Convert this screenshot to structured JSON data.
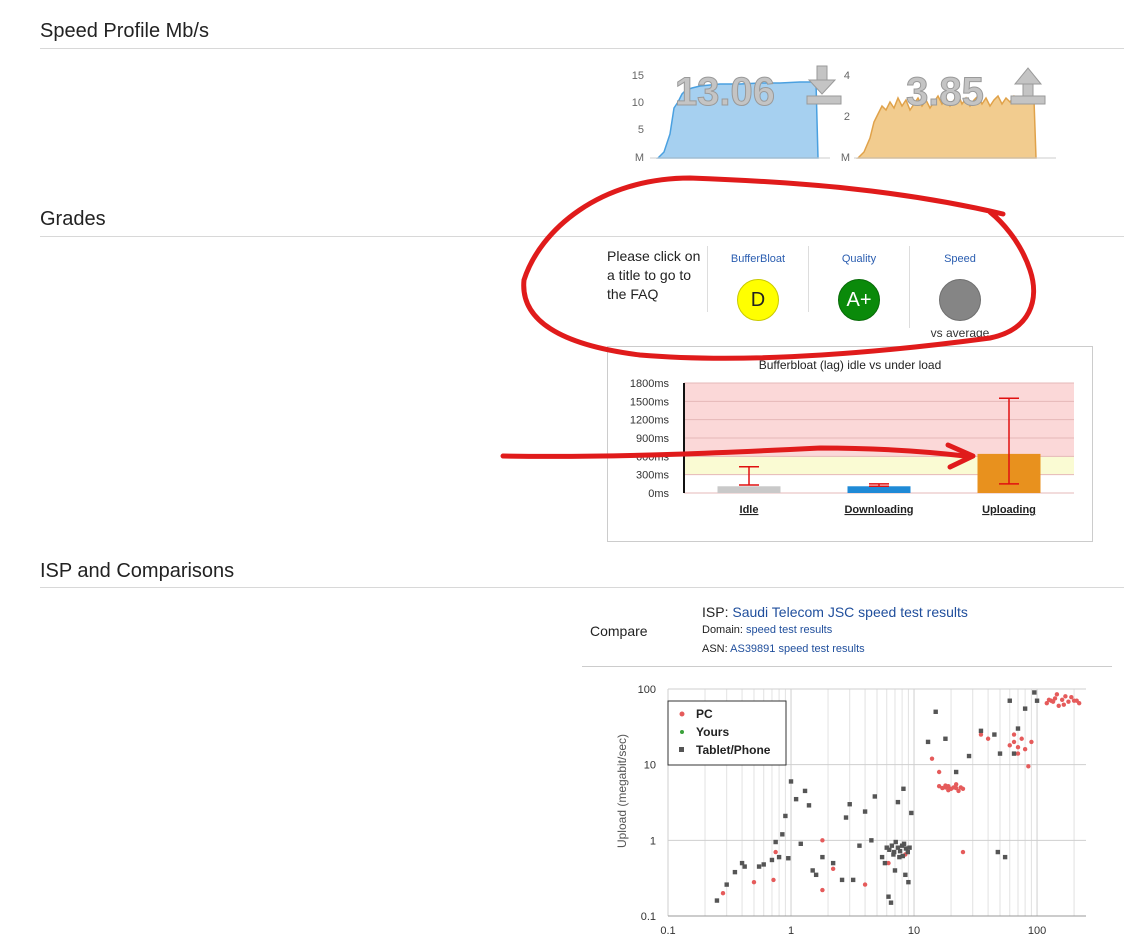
{
  "sections": {
    "speed_profile": "Speed Profile Mb/s",
    "grades": "Grades",
    "isp": "ISP and Comparisons"
  },
  "speed_profile": {
    "download_value": "13.06",
    "upload_value": "3.85",
    "download_axis": [
      "15",
      "10",
      "5",
      "M"
    ],
    "upload_axis": [
      "4",
      "2",
      "M"
    ],
    "download_color": "#6ab0e6",
    "upload_color": "#f0c37a"
  },
  "grades": {
    "intro": "Please click on a title to go to the FAQ",
    "items": [
      {
        "title": "BufferBloat",
        "grade": "D",
        "color": "#ffff00",
        "text_color": "#222"
      },
      {
        "title": "Quality",
        "grade": "A+",
        "color": "#0a8a0a",
        "text_color": "#ffffff"
      },
      {
        "title": "Speed",
        "grade": "",
        "color": "#858585",
        "text_color": "#ffffff",
        "sub": "vs average"
      }
    ]
  },
  "chart_data": [
    {
      "type": "bar",
      "title": "Bufferbloat (lag) idle vs under load",
      "categories": [
        "Idle",
        "Downloading",
        "Uploading"
      ],
      "y_tick_labels": [
        "1800ms",
        "1500ms",
        "1200ms",
        "900ms",
        "600ms",
        "300ms",
        "0ms"
      ],
      "ylim": [
        0,
        1800
      ],
      "values": [
        110,
        110,
        640
      ],
      "error_ranges": [
        [
          130,
          430
        ],
        [
          110,
          150
        ],
        [
          150,
          1550
        ]
      ],
      "colors": [
        "#c9c9c9",
        "#1f8ad6",
        "#e8911e"
      ],
      "zones": [
        {
          "from": 0,
          "to": 300,
          "color": "#ffffff"
        },
        {
          "from": 300,
          "to": 600,
          "color": "#fafbd3"
        },
        {
          "from": 600,
          "to": 1800,
          "color": "#fbd8d8"
        }
      ]
    },
    {
      "type": "scatter",
      "ylabel": "Upload (megabit/sec)",
      "x_scale": "log",
      "y_scale": "log",
      "xlim": [
        0.1,
        250
      ],
      "ylim": [
        0.1,
        100
      ],
      "x_tick_labels": [
        "0.1",
        "1",
        "10",
        "100"
      ],
      "y_tick_labels": [
        "100",
        "10",
        "1",
        "0.1"
      ],
      "legend_position": "top-left",
      "series": [
        {
          "name": "PC",
          "color": "#e55b5b",
          "shape": "circle",
          "points": [
            [
              0.28,
              0.2
            ],
            [
              0.5,
              0.28
            ],
            [
              0.72,
              0.3
            ],
            [
              1.8,
              0.22
            ],
            [
              2.2,
              0.42
            ],
            [
              4,
              0.26
            ],
            [
              6.2,
              0.5
            ],
            [
              8.5,
              0.65
            ],
            [
              1.8,
              1.0
            ],
            [
              0.75,
              0.7
            ],
            [
              14,
              12
            ],
            [
              16,
              8
            ],
            [
              18,
              5
            ],
            [
              19,
              5.2
            ],
            [
              20,
              4.8
            ],
            [
              21,
              5
            ],
            [
              22,
              5.5
            ],
            [
              23,
              4.5
            ],
            [
              24,
              5
            ],
            [
              25,
              4.8
            ],
            [
              16,
              5.2
            ],
            [
              17,
              4.9
            ],
            [
              18,
              5.3
            ],
            [
              19,
              4.6
            ],
            [
              22,
              4.9
            ],
            [
              25,
              0.7
            ],
            [
              35,
              25
            ],
            [
              40,
              22
            ],
            [
              60,
              18
            ],
            [
              65,
              20
            ],
            [
              70,
              17
            ],
            [
              75,
              22
            ],
            [
              80,
              16
            ],
            [
              85,
              9.5
            ],
            [
              65,
              25
            ],
            [
              70,
              14
            ],
            [
              90,
              20
            ],
            [
              120,
              65
            ],
            [
              130,
              70
            ],
            [
              140,
              75
            ],
            [
              150,
              60
            ],
            [
              160,
              72
            ],
            [
              170,
              80
            ],
            [
              180,
              68
            ],
            [
              200,
              70
            ],
            [
              220,
              65
            ],
            [
              135,
              68
            ],
            [
              125,
              72
            ],
            [
              190,
              78
            ],
            [
              165,
              62
            ],
            [
              145,
              85
            ],
            [
              210,
              70
            ]
          ]
        },
        {
          "name": "Yours",
          "color": "#3aa13a",
          "shape": "circle",
          "points": []
        },
        {
          "name": "Tablet/Phone",
          "color": "#555555",
          "shape": "square",
          "points": [
            [
              0.25,
              0.16
            ],
            [
              0.3,
              0.26
            ],
            [
              0.35,
              0.38
            ],
            [
              0.4,
              0.5
            ],
            [
              0.42,
              0.45
            ],
            [
              0.55,
              0.45
            ],
            [
              0.6,
              0.48
            ],
            [
              0.7,
              0.55
            ],
            [
              0.75,
              0.95
            ],
            [
              0.8,
              0.6
            ],
            [
              0.85,
              1.2
            ],
            [
              0.9,
              2.1
            ],
            [
              0.95,
              0.58
            ],
            [
              1.0,
              6
            ],
            [
              1.1,
              3.5
            ],
            [
              1.2,
              0.9
            ],
            [
              1.3,
              4.5
            ],
            [
              1.4,
              2.9
            ],
            [
              1.5,
              0.4
            ],
            [
              1.6,
              0.35
            ],
            [
              1.8,
              0.6
            ],
            [
              2.2,
              0.5
            ],
            [
              2.6,
              0.3
            ],
            [
              2.8,
              2.0
            ],
            [
              3.0,
              3.0
            ],
            [
              3.2,
              0.3
            ],
            [
              3.6,
              0.85
            ],
            [
              4.0,
              2.4
            ],
            [
              4.5,
              1.0
            ],
            [
              4.8,
              3.8
            ],
            [
              5.5,
              0.6
            ],
            [
              5.8,
              0.5
            ],
            [
              6.2,
              0.18
            ],
            [
              6.5,
              0.15
            ],
            [
              6.0,
              0.8
            ],
            [
              6.3,
              0.75
            ],
            [
              6.6,
              0.85
            ],
            [
              6.9,
              0.7
            ],
            [
              7.1,
              0.95
            ],
            [
              7.4,
              0.8
            ],
            [
              7.7,
              0.72
            ],
            [
              8.0,
              0.85
            ],
            [
              8.3,
              0.9
            ],
            [
              8.6,
              0.78
            ],
            [
              8.9,
              0.7
            ],
            [
              9.2,
              0.8
            ],
            [
              6.8,
              0.65
            ],
            [
              7.6,
              0.6
            ],
            [
              8.1,
              0.62
            ],
            [
              7.0,
              0.4
            ],
            [
              8.5,
              0.35
            ],
            [
              9.0,
              0.28
            ],
            [
              7.4,
              3.2
            ],
            [
              8.2,
              4.8
            ],
            [
              9.5,
              2.3
            ],
            [
              13,
              20
            ],
            [
              15,
              50
            ],
            [
              18,
              22
            ],
            [
              22,
              8
            ],
            [
              28,
              13
            ],
            [
              35,
              28
            ],
            [
              45,
              25
            ],
            [
              48,
              0.7
            ],
            [
              50,
              14
            ],
            [
              55,
              0.6
            ],
            [
              65,
              14
            ],
            [
              70,
              30
            ],
            [
              80,
              55
            ],
            [
              95,
              90
            ],
            [
              60,
              70
            ],
            [
              100,
              70
            ]
          ]
        }
      ]
    }
  ],
  "isp": {
    "compare_label": "Compare",
    "isp_label": "ISP:",
    "isp_value": "Saudi Telecom JSC speed test results",
    "domain_label": "Domain:",
    "domain_value": "speed test results",
    "asn_label": "ASN:",
    "asn_value": "AS39891 speed test results"
  },
  "annotations": {
    "mark_color": "#e01b1b"
  }
}
